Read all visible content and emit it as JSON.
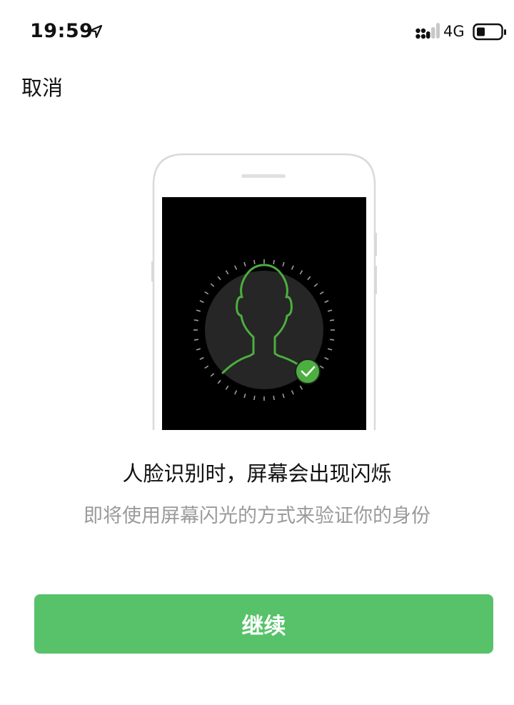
{
  "status_bar": {
    "time": "19:59",
    "network": "4G",
    "icons": [
      "location-arrow-icon",
      "signal-icon",
      "battery-icon"
    ]
  },
  "nav": {
    "cancel_label": "取消"
  },
  "content": {
    "title": "人脸识别时，屏幕会出现闪烁",
    "subtitle": "即将使用屏幕闪光的方式来验证你的身份"
  },
  "action": {
    "continue_label": "继续"
  },
  "colors": {
    "accent": "#57c26a",
    "face_outline": "#4caf3f",
    "subtitle_text": "#9a9a9a",
    "screen": "#000000"
  }
}
